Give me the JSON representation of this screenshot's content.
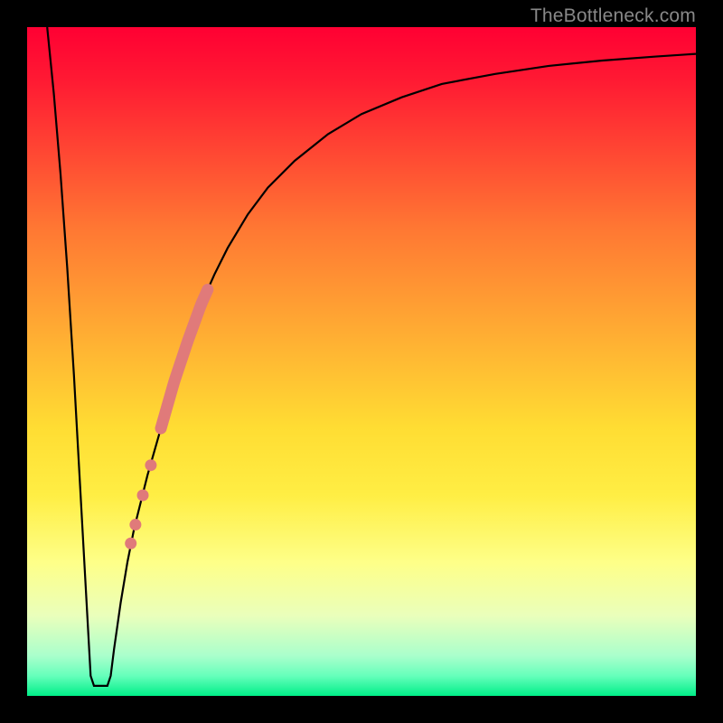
{
  "watermark": "TheBottleneck.com",
  "colors": {
    "curve": "#000000",
    "highlight": "#e07a7a",
    "bg_top": "#ff0033",
    "bg_bottom": "#00ee88",
    "frame": "#000000"
  },
  "chart_data": {
    "type": "line",
    "title": "",
    "xlabel": "",
    "ylabel": "",
    "xlim": [
      0,
      100
    ],
    "ylim": [
      0,
      100
    ],
    "grid": false,
    "curve": [
      {
        "x": 3.0,
        "y": 100.0
      },
      {
        "x": 4.0,
        "y": 90.0
      },
      {
        "x": 5.0,
        "y": 78.0
      },
      {
        "x": 6.0,
        "y": 64.0
      },
      {
        "x": 7.0,
        "y": 48.0
      },
      {
        "x": 8.0,
        "y": 30.0
      },
      {
        "x": 9.0,
        "y": 12.0
      },
      {
        "x": 9.5,
        "y": 3.0
      },
      {
        "x": 10.0,
        "y": 1.5
      },
      {
        "x": 11.0,
        "y": 1.5
      },
      {
        "x": 12.0,
        "y": 1.5
      },
      {
        "x": 12.5,
        "y": 3.0
      },
      {
        "x": 13.0,
        "y": 7.0
      },
      {
        "x": 14.0,
        "y": 14.0
      },
      {
        "x": 15.0,
        "y": 20.0
      },
      {
        "x": 16.0,
        "y": 25.0
      },
      {
        "x": 17.0,
        "y": 29.0
      },
      {
        "x": 18.0,
        "y": 33.0
      },
      {
        "x": 20.0,
        "y": 40.0
      },
      {
        "x": 22.0,
        "y": 47.0
      },
      {
        "x": 24.0,
        "y": 53.0
      },
      {
        "x": 26.0,
        "y": 58.5
      },
      {
        "x": 28.0,
        "y": 63.0
      },
      {
        "x": 30.0,
        "y": 67.0
      },
      {
        "x": 33.0,
        "y": 72.0
      },
      {
        "x": 36.0,
        "y": 76.0
      },
      {
        "x": 40.0,
        "y": 80.0
      },
      {
        "x": 45.0,
        "y": 84.0
      },
      {
        "x": 50.0,
        "y": 87.0
      },
      {
        "x": 56.0,
        "y": 89.5
      },
      {
        "x": 62.0,
        "y": 91.5
      },
      {
        "x": 70.0,
        "y": 93.0
      },
      {
        "x": 78.0,
        "y": 94.2
      },
      {
        "x": 86.0,
        "y": 95.0
      },
      {
        "x": 94.0,
        "y": 95.6
      },
      {
        "x": 100.0,
        "y": 96.0
      }
    ],
    "highlight_segment": {
      "start_x": 20.0,
      "end_x": 27.0
    },
    "highlight_dots": [
      {
        "x": 18.5,
        "y": 34.5
      },
      {
        "x": 17.3,
        "y": 30.0
      },
      {
        "x": 16.2,
        "y": 25.6
      },
      {
        "x": 15.5,
        "y": 22.8
      }
    ]
  }
}
